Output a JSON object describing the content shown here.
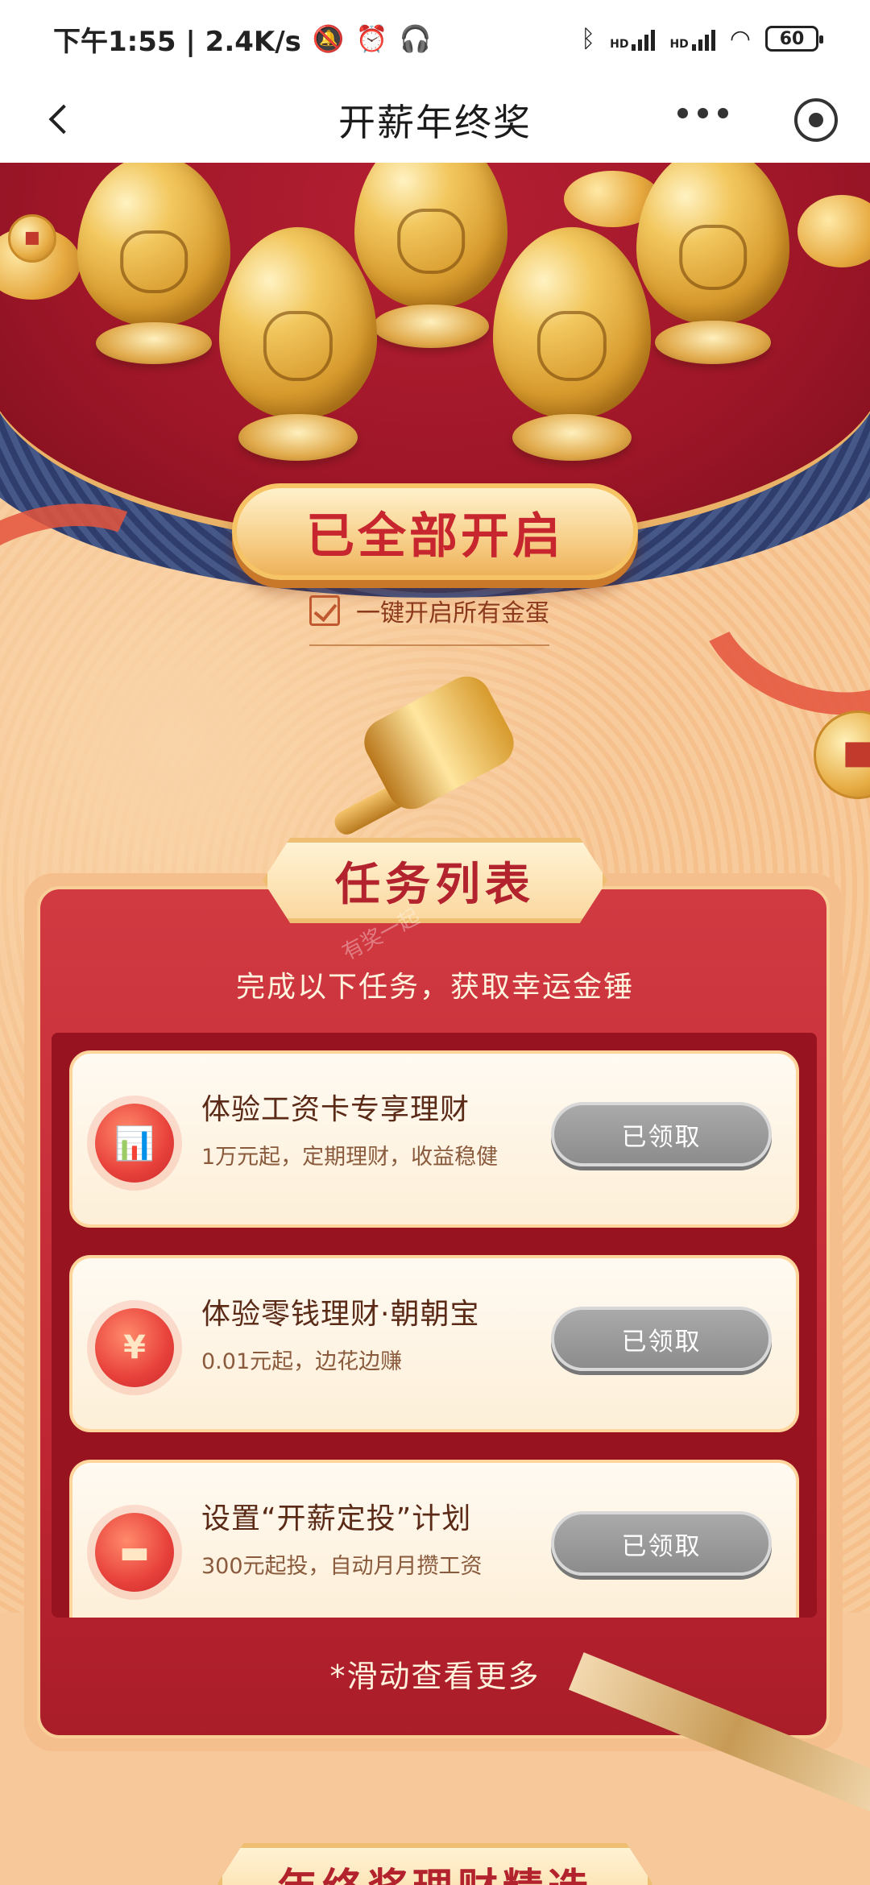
{
  "status_bar": {
    "time_speed": "下午1:55 | 2.4K/s",
    "battery": "60",
    "icons": [
      "bell-off-icon",
      "alarm-icon",
      "headset-icon",
      "bluetooth-icon",
      "signal-hd-icon",
      "signal-hd-icon",
      "wifi-icon",
      "battery-icon"
    ],
    "hd_label": "HD"
  },
  "nav": {
    "title": "开薪年终奖",
    "icons": [
      "back-icon",
      "more-icon",
      "target-icon"
    ]
  },
  "hero": {
    "open_all_button": "已全部开启",
    "one_key_label": "一键开启所有金蛋",
    "one_key_checked": true,
    "eggs": [
      "egg-icon",
      "egg-icon",
      "egg-icon",
      "egg-icon",
      "egg-icon"
    ]
  },
  "tasks": {
    "title": "任务列表",
    "subtitle": "完成以下任务，获取幸运金锤",
    "items": [
      {
        "name": "体验工资卡专享理财",
        "desc": "1万元起，定期理财，收益稳健",
        "button": "已领取",
        "icon": "chart-icon"
      },
      {
        "name": "体验零钱理财·朝朝宝",
        "desc": "0.01元起，边花边赚",
        "button": "已领取",
        "icon": "money-bag-icon"
      },
      {
        "name": "设置“开薪定投”计划",
        "desc": "300元起投，自动月月攒工资",
        "button": "已领取",
        "icon": "card-icon"
      }
    ],
    "scroll_more": "*滑动查看更多"
  },
  "footer_title": "年终奖理财精选",
  "watermark": "有奖一起",
  "colors": {
    "primary_red": "#c8262e",
    "button_disabled": "#9a9a9a",
    "panel_bg": "#bd2532"
  }
}
